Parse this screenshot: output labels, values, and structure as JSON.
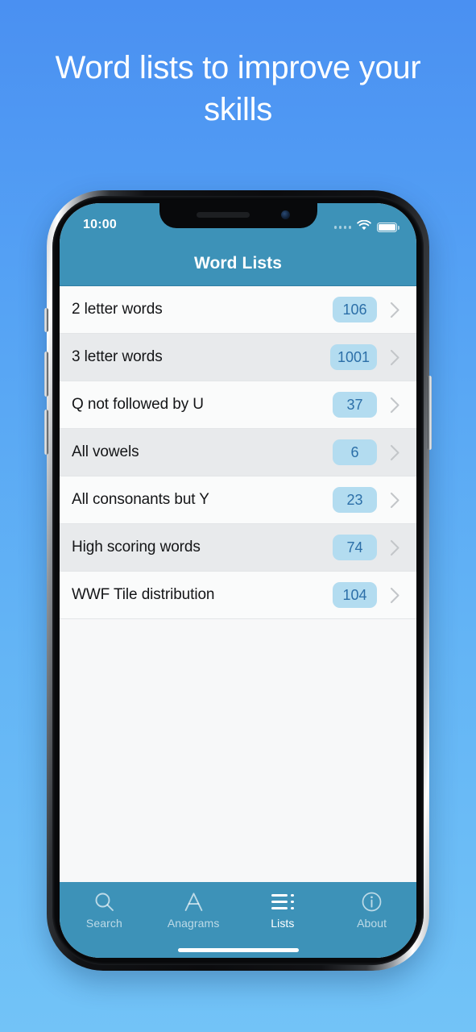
{
  "promo": {
    "headline": "Word lists to improve your skills",
    "background_top": "#4a90f2",
    "background_bottom": "#72c3f7"
  },
  "statusbar": {
    "time": "10:00",
    "signal_icon": "signal-dots-icon",
    "wifi_icon": "wifi-icon",
    "battery_icon": "battery-full-icon"
  },
  "navbar": {
    "title": "Word Lists",
    "bar_color": "#3d92b8"
  },
  "list": {
    "rows": [
      {
        "label": "2 letter words",
        "count": "106"
      },
      {
        "label": "3 letter words",
        "count": "1001"
      },
      {
        "label": "Q not followed by U",
        "count": "37"
      },
      {
        "label": "All vowels",
        "count": "6"
      },
      {
        "label": "All consonants but Y",
        "count": "23"
      },
      {
        "label": "High scoring words",
        "count": "74"
      },
      {
        "label": "WWF Tile distribution",
        "count": "104"
      }
    ],
    "badge_bg": "#b3dcf0",
    "badge_fg": "#2c6fa8",
    "chevron_icon": "chevron-right-icon"
  },
  "tabbar": {
    "tabs": [
      {
        "label": "Search",
        "icon": "search-icon",
        "active": false
      },
      {
        "label": "Anagrams",
        "icon": "letter-a-icon",
        "active": false
      },
      {
        "label": "Lists",
        "icon": "list-icon",
        "active": true
      },
      {
        "label": "About",
        "icon": "info-circle-icon",
        "active": false
      }
    ]
  }
}
